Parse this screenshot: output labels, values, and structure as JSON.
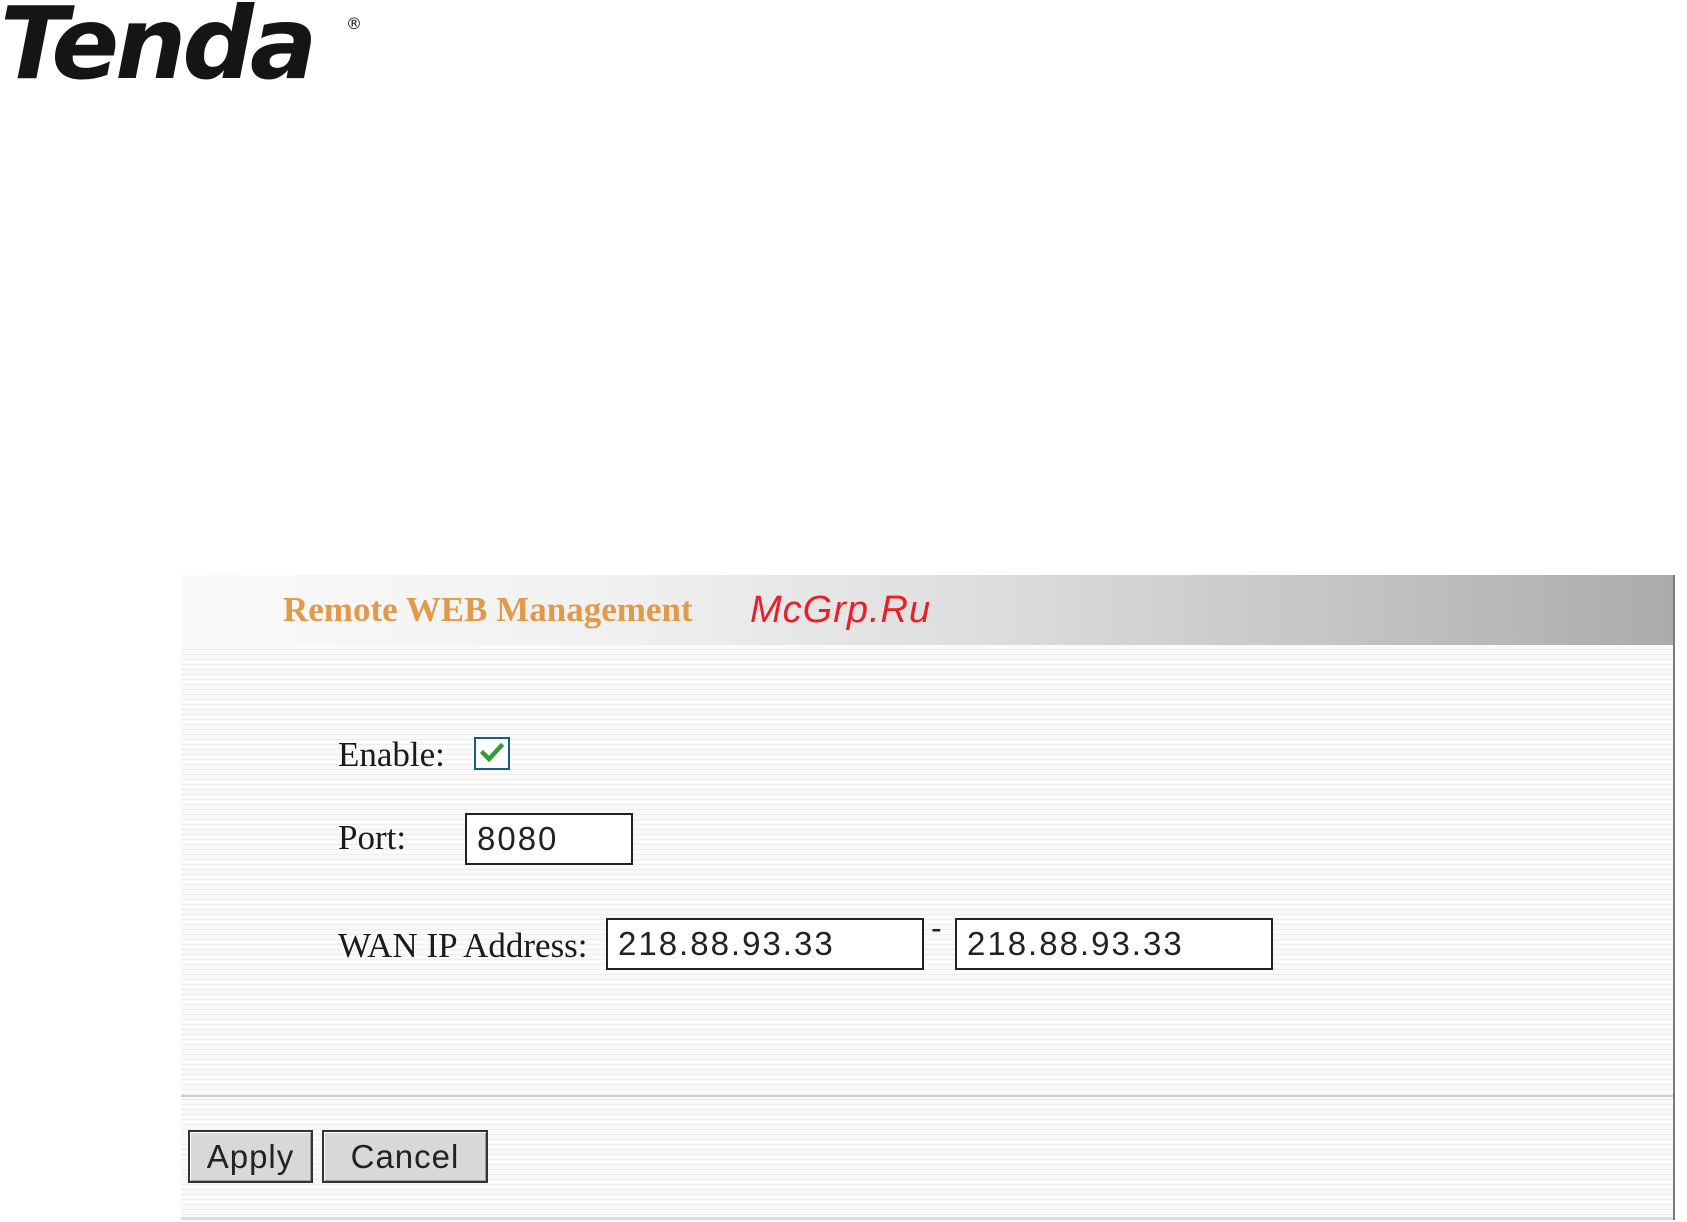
{
  "logo": {
    "text": "Tenda",
    "registered": "®"
  },
  "panel": {
    "title": "Remote WEB Management",
    "watermark": "McGrp.Ru"
  },
  "form": {
    "enable_label": "Enable:",
    "enable_checked": true,
    "port_label": "Port:",
    "port_value": "8080",
    "wan_label": "WAN IP Address:",
    "wan_start": "218.88.93.33",
    "wan_separator": "-",
    "wan_end": "218.88.93.33"
  },
  "buttons": {
    "apply": "Apply",
    "cancel": "Cancel"
  },
  "colors": {
    "title": "#e09a4a",
    "watermark": "#e8202a",
    "checkmark": "#2e9e3a"
  }
}
